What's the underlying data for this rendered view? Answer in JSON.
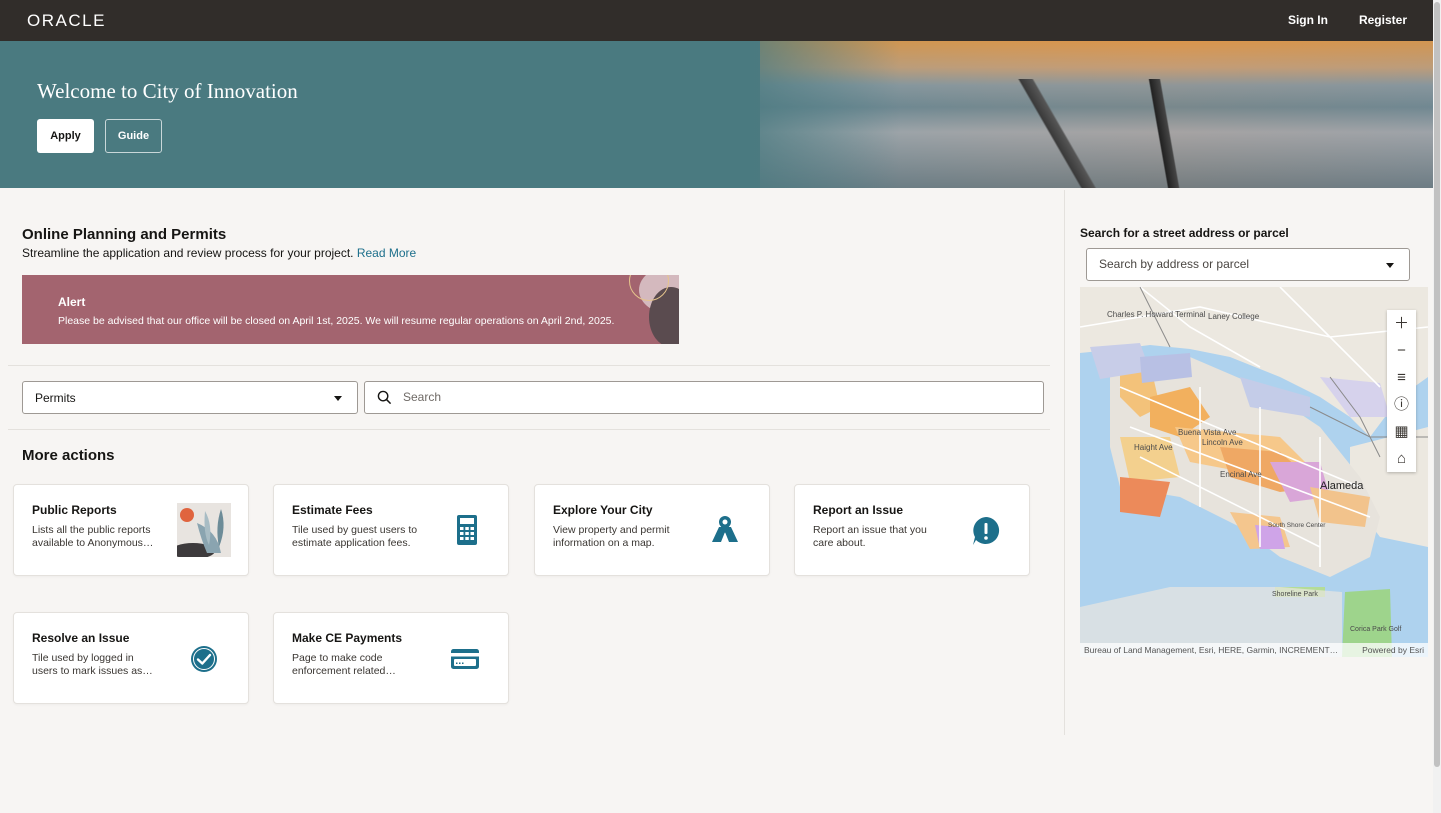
{
  "topbar": {
    "logo": "ORACLE",
    "sign_in": "Sign In",
    "register": "Register"
  },
  "hero": {
    "title": "Welcome to City of Innovation",
    "apply_label": "Apply",
    "guide_label": "Guide"
  },
  "intro": {
    "title": "Online Planning and Permits",
    "description": "Streamline the application and review process for your project.",
    "read_more": "Read More"
  },
  "alert": {
    "title": "Alert",
    "message": "Please be advised that our office will be closed on April 1st, 2025. We will resume regular operations on April 2nd, 2025."
  },
  "search": {
    "category_value": "Permits",
    "placeholder": "Search"
  },
  "more_actions": {
    "title": "More actions",
    "tiles": [
      {
        "title": "Public Reports",
        "description": "Lists all the public reports available to Anonymous…",
        "icon": "report-illustration-icon"
      },
      {
        "title": "Estimate Fees",
        "description": "Tile used by guest users to estimate application fees.",
        "icon": "calculator-icon"
      },
      {
        "title": "Explore Your City",
        "description": "View property and permit information on a map.",
        "icon": "map-pin-icon"
      },
      {
        "title": "Report an Issue",
        "description": "Report an issue that you care about.",
        "icon": "alert-bubble-icon"
      },
      {
        "title": "Resolve an Issue",
        "description": "Tile used by logged in users to mark issues as…",
        "icon": "check-circle-icon"
      },
      {
        "title": "Make CE Payments",
        "description": "Page to make code enforcement related…",
        "icon": "credit-card-icon"
      }
    ]
  },
  "map": {
    "label": "Search for a street address or parcel",
    "placeholder": "Search by address or parcel",
    "attribution": "Bureau of Land Management, Esri, HERE, Garmin, INCREMENT…",
    "powered_by": "Powered by Esri",
    "labels": {
      "howard": "Charles P. Howard Terminal",
      "laney": "Laney College",
      "alameda": "Alameda",
      "buena_vista": "Buena Vista Ave",
      "lincoln": "Lincoln Ave",
      "haight": "Haight Ave",
      "encinal": "Encinal Ave",
      "shoreline": "Shoreline Park",
      "corica": "Corica Park Golf",
      "south_shore": "South Shore Center"
    }
  },
  "colors": {
    "topbar": "#312d2a",
    "hero": "#4a7a80",
    "alert": "#a3646f",
    "accent": "#1d6f8b",
    "page": "#f7f5f3"
  }
}
